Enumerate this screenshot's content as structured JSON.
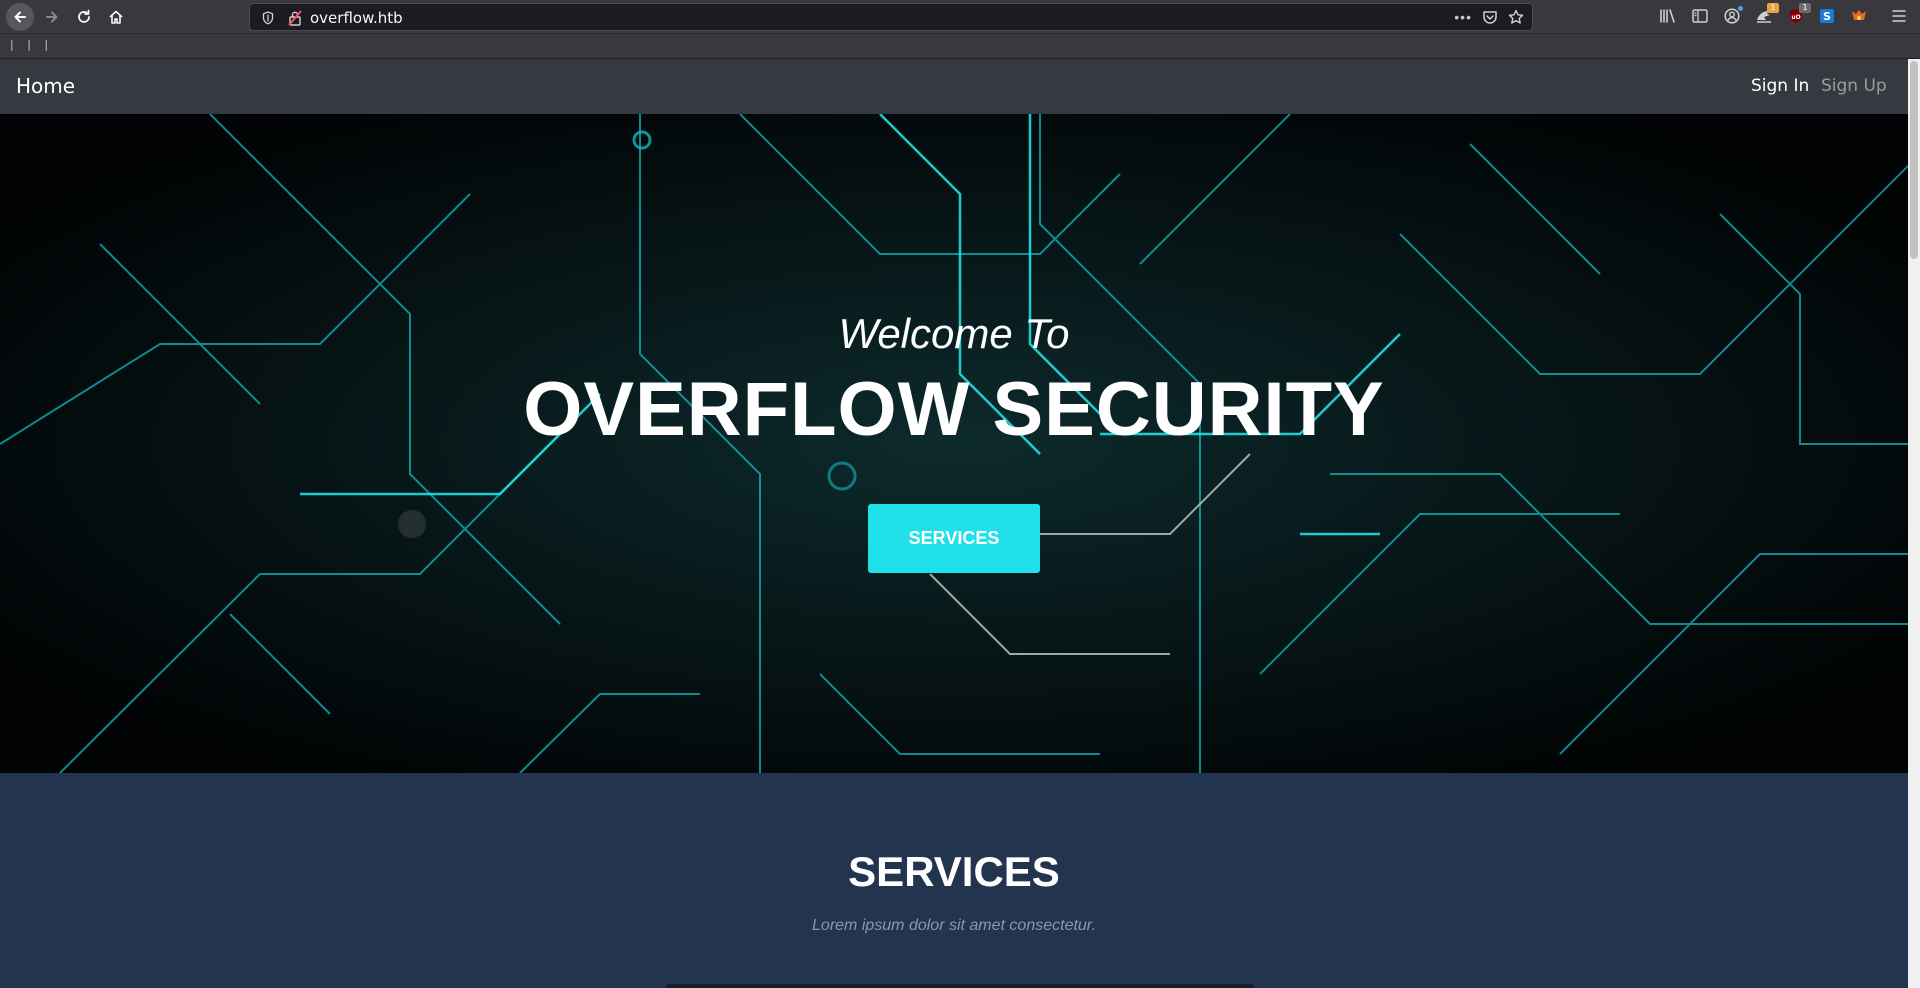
{
  "browser": {
    "url": "overflow.htb",
    "more_label": "•••",
    "bookmarks_marks": "| | |",
    "extensions": [
      {
        "name": "library-icon"
      },
      {
        "name": "sidebar-icon"
      },
      {
        "name": "account-icon"
      },
      {
        "name": "extension-a-icon",
        "badge": "1",
        "badge_color": "#e8a33d"
      },
      {
        "name": "ublock-icon",
        "badge": "1",
        "badge_color": "#6d6d6d"
      },
      {
        "name": "extension-s-icon"
      },
      {
        "name": "foxyproxy-icon"
      }
    ]
  },
  "navbar": {
    "home_label": "Home",
    "signin_label": "Sign In",
    "signup_label": "Sign Up"
  },
  "hero": {
    "welcome_text": "Welcome To",
    "title": "OVERFLOW SECURITY",
    "button_label": "SERVICES",
    "accent_color": "#20e0ea"
  },
  "services": {
    "heading": "SERVICES",
    "subheading": "Lorem ipsum dolor sit amet consectetur."
  },
  "colors": {
    "navbar_bg": "#343a40",
    "services_bg": "#22344e",
    "circuit_teal": "#17c7cc"
  }
}
